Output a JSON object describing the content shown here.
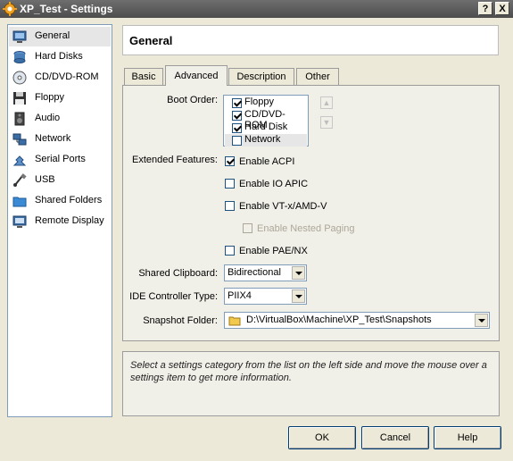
{
  "window": {
    "title": "XP_Test - Settings",
    "help_button": "?",
    "close_button": "X"
  },
  "sidebar": {
    "items": [
      {
        "label": "General",
        "icon": "monitor-icon"
      },
      {
        "label": "Hard Disks",
        "icon": "hard-disk-icon"
      },
      {
        "label": "CD/DVD-ROM",
        "icon": "cd-icon"
      },
      {
        "label": "Floppy",
        "icon": "floppy-icon"
      },
      {
        "label": "Audio",
        "icon": "speaker-icon"
      },
      {
        "label": "Network",
        "icon": "network-icon"
      },
      {
        "label": "Serial Ports",
        "icon": "serial-port-icon"
      },
      {
        "label": "USB",
        "icon": "usb-icon"
      },
      {
        "label": "Shared Folders",
        "icon": "folder-icon"
      },
      {
        "label": "Remote Display",
        "icon": "remote-display-icon"
      }
    ]
  },
  "header": {
    "title": "General"
  },
  "tabs": [
    "Basic",
    "Advanced",
    "Description",
    "Other"
  ],
  "advanced": {
    "boot_order_label": "Boot Order:",
    "boot_items": [
      {
        "label": "Floppy",
        "checked": true
      },
      {
        "label": "CD/DVD-ROM",
        "checked": true
      },
      {
        "label": "Hard Disk",
        "checked": true
      },
      {
        "label": "Network",
        "checked": false
      }
    ],
    "extended_features_label": "Extended Features:",
    "enable_acpi": "Enable ACPI",
    "enable_io_apic": "Enable IO APIC",
    "enable_vtx": "Enable VT-x/AMD-V",
    "enable_nested_paging": "Enable Nested Paging",
    "enable_pae": "Enable PAE/NX",
    "shared_clipboard_label": "Shared Clipboard:",
    "shared_clipboard_value": "Bidirectional",
    "ide_controller_label": "IDE Controller Type:",
    "ide_controller_value": "PIIX4",
    "snapshot_folder_label": "Snapshot Folder:",
    "snapshot_folder_value": "D:\\VirtualBox\\Machine\\XP_Test\\Snapshots"
  },
  "info_text": "Select a settings category from the list on the left side and move the mouse over a settings item to get more information.",
  "buttons": {
    "ok": "OK",
    "cancel": "Cancel",
    "help": "Help"
  },
  "colors": {
    "titlebar": "#5a5a5a",
    "selection": "#e6e6e6",
    "dialog_bg": "#ece9d8"
  }
}
